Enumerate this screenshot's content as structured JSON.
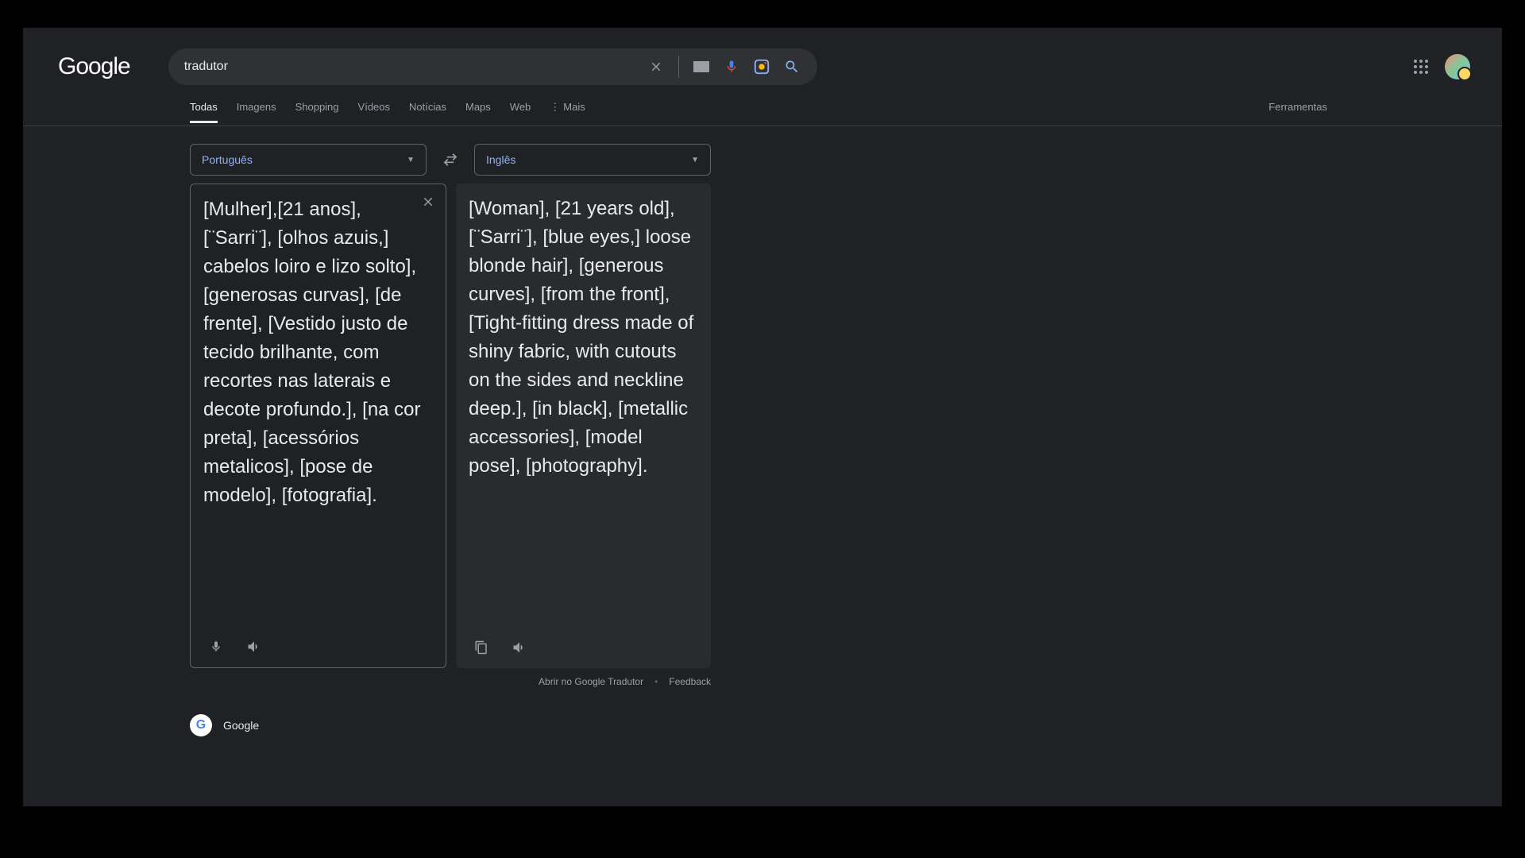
{
  "logo": "Google",
  "search": {
    "value": "tradutor"
  },
  "tabs": {
    "items": [
      "Todas",
      "Imagens",
      "Shopping",
      "Vídeos",
      "Notícias",
      "Maps",
      "Web"
    ],
    "more": "Mais",
    "tools": "Ferramentas",
    "active_index": 0
  },
  "translator": {
    "source_lang": "Português",
    "target_lang": "Inglês",
    "source_text": "[Mulher],[21 anos], [¨Sarri¨], [olhos azuis,] cabelos loiro e lizo solto], [generosas curvas], [de frente], [Vestido justo de tecido brilhante, com recortes nas laterais e decote profundo.], [na cor preta], [acessórios metalicos], [pose de modelo], [fotografia].",
    "target_text": "[Woman], [21 years old], [¨Sarri¨], [blue eyes,] loose blonde hair], [generous curves], [from the front], [Tight-fitting dress made of shiny fabric, with cutouts on the sides and neckline deep.], [in black], [metallic accessories], [model pose], [photography].",
    "open_link": "Abrir no Google Tradutor",
    "feedback": "Feedback"
  },
  "first_result": {
    "title": "Google"
  }
}
